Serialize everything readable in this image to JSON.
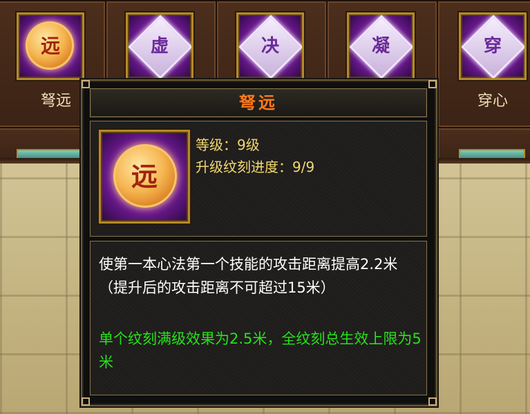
{
  "skills": [
    {
      "label": "弩远",
      "glyph": "远",
      "style": "coin"
    },
    {
      "label": "",
      "glyph": "虚",
      "style": "gem"
    },
    {
      "label": "",
      "glyph": "决",
      "style": "gem"
    },
    {
      "label": "",
      "glyph": "凝",
      "style": "gem"
    },
    {
      "label": "穿心",
      "glyph": "穿",
      "style": "gem"
    }
  ],
  "tooltip": {
    "title": "弩远",
    "icon_glyph": "远",
    "level_line": "等级：9级",
    "progress_line": "升级纹刻进度：9/9",
    "description": "使第一本心法第一个技能的攻击距离提高2.2米（提升后的攻击距离不可超过15米）",
    "note": "单个纹刻满级效果为2.5米，全纹刻总生效上限为5米"
  }
}
